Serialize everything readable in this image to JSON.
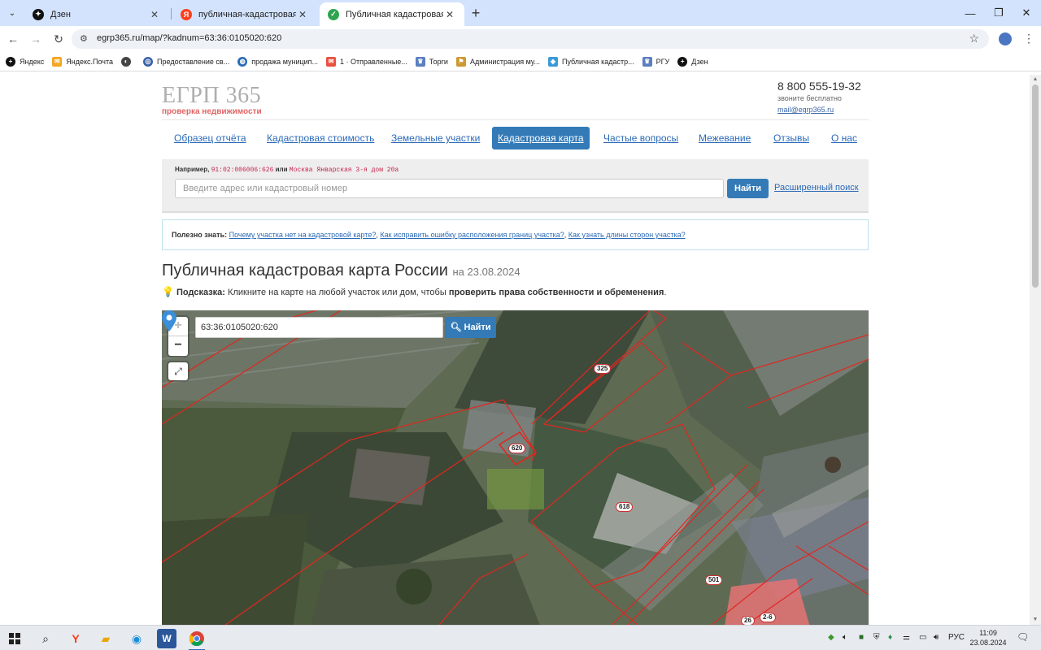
{
  "browser": {
    "tabs": [
      {
        "title": "Дзен",
        "favicon": "zen-icon",
        "active": false
      },
      {
        "title": "публичная-кадастровая-карта",
        "favicon": "yandex-icon",
        "active": false
      },
      {
        "title": "Публичная кадастровая карта",
        "favicon": "check-icon",
        "active": true
      }
    ],
    "url": "egrp365.ru/map/?kadnum=63:36:0105020:620",
    "bookmarks": [
      {
        "label": "Яндекс",
        "icon": "zen-icon"
      },
      {
        "label": "Яндекс.Почта",
        "icon": "mail-icon"
      },
      {
        "label": "",
        "icon": "globe-icon"
      },
      {
        "label": "Предоставление св...",
        "icon": "gov-icon"
      },
      {
        "label": "продажа муницип...",
        "icon": "globe-icon"
      },
      {
        "label": "1 · Отправленные...",
        "icon": "mail-icon"
      },
      {
        "label": "Торги",
        "icon": "emblem-icon"
      },
      {
        "label": "Администрация му...",
        "icon": "flag-icon"
      },
      {
        "label": "Публичная кадастр...",
        "icon": "cadastre-icon"
      },
      {
        "label": "РГУ",
        "icon": "emblem-icon"
      },
      {
        "label": "Дзен",
        "icon": "zen-icon"
      }
    ]
  },
  "site": {
    "logo": "ЕГРП 365",
    "logo_sub": "проверка недвижимости",
    "phone": "8 800 555-19-32",
    "phone_note": "звоните бесплатно",
    "email": "mail@egrp365.ru",
    "nav": [
      {
        "label": "Образец отчёта",
        "active": false
      },
      {
        "label": "Кадастровая стоимость",
        "active": false
      },
      {
        "label": "Земельные участки",
        "active": false
      },
      {
        "label": "Кадастровая карта",
        "active": true
      },
      {
        "label": "Частые вопросы",
        "active": false
      },
      {
        "label": "Межевание",
        "active": false
      },
      {
        "label": "Отзывы",
        "active": false
      },
      {
        "label": "О нас",
        "active": false
      }
    ],
    "search": {
      "example_prefix": "Например,",
      "example_code1": "91:02:006006:626",
      "example_or": "или",
      "example_code2": "Москва Январская 3-я дом 20а",
      "placeholder": "Введите адрес или кадастровый номер",
      "button": "Найти",
      "advanced": "Расширенный поиск"
    },
    "useful": {
      "label": "Полезно знать:",
      "links": [
        "Почему участка нет на кадастровой карте?",
        "Как исправить ошибку расположения границ участка?",
        "Как узнать длины сторон участка?"
      ]
    },
    "title": "Публичная кадастровая карта России",
    "title_date": "на 23.08.2024",
    "hint_label": "Подсказка:",
    "hint_text": "Кликните на карте на любой участок или дом, чтобы",
    "hint_bold": "проверить права собственности и обременения",
    "hint_end": "."
  },
  "map": {
    "search_value": "63:36:0105020:620",
    "search_button": "Найти",
    "zoom_in": "+",
    "zoom_out": "−",
    "parcels": [
      "325",
      "620",
      "618",
      "501",
      "26",
      "2-6"
    ]
  },
  "taskbar": {
    "language": "РУС",
    "time": "11:09",
    "date": "23.08.2024"
  },
  "colors": {
    "accent": "#337ab7",
    "link": "#2a6ab8",
    "parcel_border": "#e0271f",
    "logo_sub": "#e06464"
  }
}
